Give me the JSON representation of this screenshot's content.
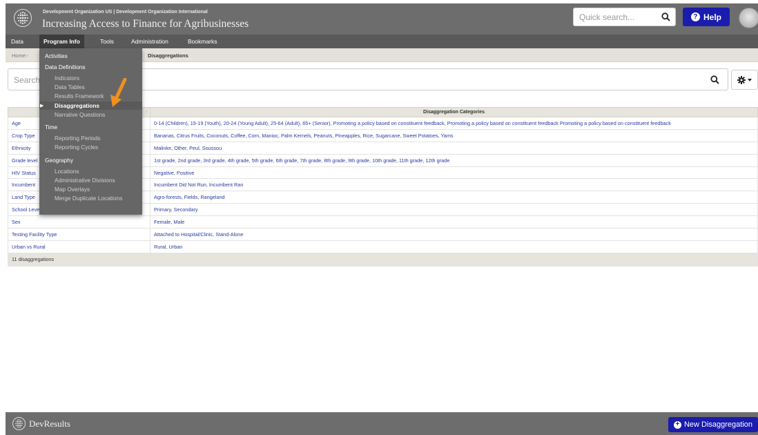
{
  "header": {
    "org_line": "Development Organization US | Development Organization International",
    "project_title": "Increasing Access to Finance for Agribusinesses",
    "quick_search_placeholder": "Quick search...",
    "help_label": "Help"
  },
  "nav": {
    "items": [
      "Data",
      "Program Info",
      "Tools",
      "Administration",
      "Bookmarks"
    ],
    "active": "Program Info"
  },
  "breadcrumb": {
    "home": "Home",
    "separator": ">",
    "current": "Disaggregations"
  },
  "search": {
    "placeholder": "Search"
  },
  "menu": {
    "activities": "Activities",
    "data_definitions": "Data Definitions",
    "indicators": "Indicators",
    "data_tables": "Data Tables",
    "results_framework": "Results Framework",
    "disaggregations": "Disaggregations",
    "narrative_questions": "Narrative Questions",
    "time": "Time",
    "reporting_periods": "Reporting Periods",
    "reporting_cycles": "Reporting Cycles",
    "geography": "Geography",
    "locations": "Locations",
    "administrative_divisions": "Administrative Divisions",
    "map_overlays": "Map Overlays",
    "merge_duplicate_locations": "Merge Duplicate Locations"
  },
  "table": {
    "header_name": "",
    "header_categories": "Disaggregation Categories",
    "rows": [
      {
        "name": "Age",
        "categories": "0-14 (Children), 15-19 (Youth), 20-24 (Young Adult), 25-64 (Adult), 65+ (Senior), Promoting a policy based on constituent feedback, Promoting a policy based on constituent feedback Promoting a policy based on constituent feedback"
      },
      {
        "name": "Crop Type",
        "categories": "Bananas, Citrus Fruits, Coconuts, Coffee, Corn, Manioc, Palm Kernels, Peanuts, Pineapples, Rice, Sugarcane, Sweet Potatoes, Yams"
      },
      {
        "name": "Ethnicity",
        "categories": "Malinke, Other, Peul, Soussou"
      },
      {
        "name": "Grade level",
        "categories": "1st grade, 2nd grade, 3rd grade, 4th grade, 5th grade, 6th grade, 7th grade, 8th grade, 9th grade, 10th grade, 11th grade, 12th grade"
      },
      {
        "name": "HIV Status",
        "categories": "Negative, Positive"
      },
      {
        "name": "Incumbent",
        "categories": "Incumbent Did Not Run, Incumbent Ran"
      },
      {
        "name": "Land Type",
        "categories": "Agro-forests, Fields, Rangeland"
      },
      {
        "name": "School Level",
        "categories": "Primary, Secondary"
      },
      {
        "name": "Sex",
        "categories": "Female, Male"
      },
      {
        "name": "Testing Facility Type",
        "categories": "Attached to Hospital/Clinic, Stand-Alone"
      },
      {
        "name": "Urban vs Rural",
        "categories": "Rural, Urban"
      }
    ],
    "footer_count": "11 disaggregations"
  },
  "footer": {
    "brand": "DevResults",
    "new_button_label": "New Disaggregation"
  },
  "colors": {
    "header_bg": "#6d6d6d",
    "nav_bg": "#5a5a5a",
    "accent_button": "#1a1cad",
    "link": "#2a3aa0",
    "arrow": "#f0901e"
  }
}
